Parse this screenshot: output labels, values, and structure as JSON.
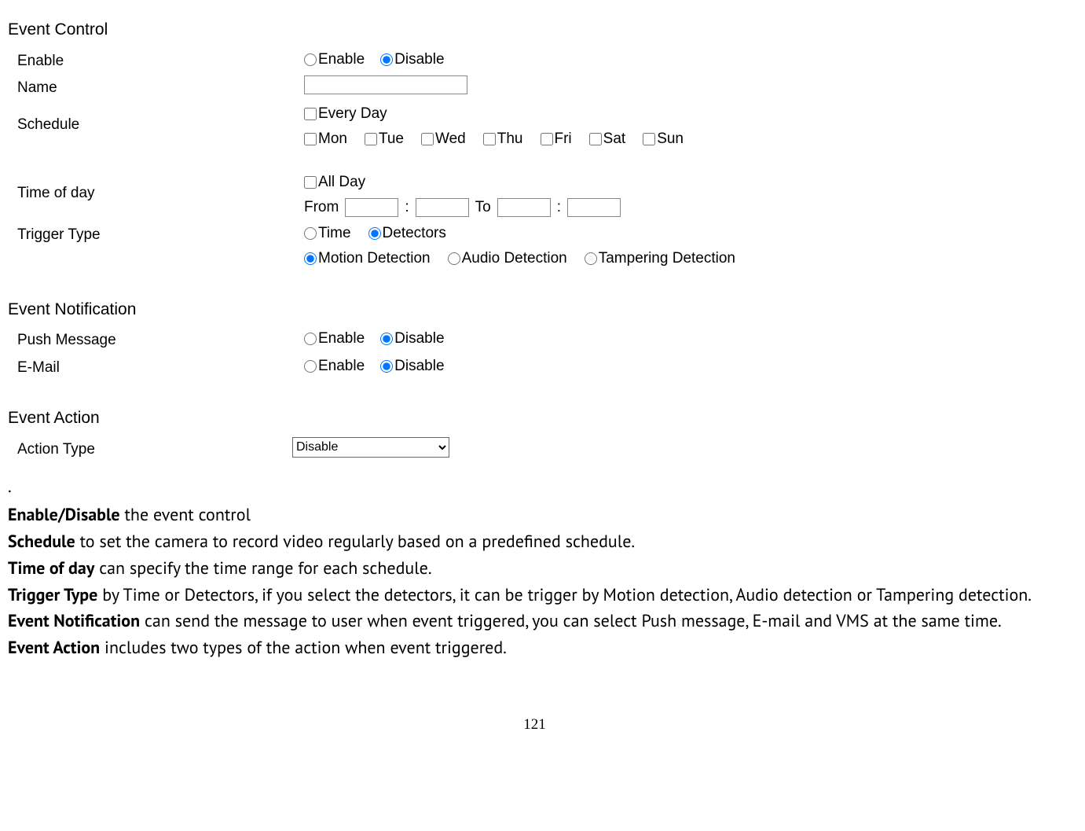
{
  "sections": {
    "event_control": "Event Control",
    "event_notification": "Event Notification",
    "event_action": "Event Action"
  },
  "labels": {
    "enable": "Enable",
    "name": "Name",
    "schedule": "Schedule",
    "time_of_day": "Time of day",
    "trigger_type": "Trigger Type",
    "push_message": "Push Message",
    "email": "E-Mail",
    "action_type": "Action Type"
  },
  "radios": {
    "enable": "Enable",
    "disable": "Disable",
    "time": "Time",
    "detectors": "Detectors",
    "motion": "Motion Detection",
    "audio": "Audio Detection",
    "tampering": "Tampering Detection"
  },
  "checks": {
    "every_day": "Every Day",
    "mon": "Mon",
    "tue": "Tue",
    "wed": "Wed",
    "thu": "Thu",
    "fri": "Fri",
    "sat": "Sat",
    "sun": "Sun",
    "all_day": "All Day"
  },
  "time": {
    "from": "From",
    "to": "To",
    "colon": ":"
  },
  "action_select": {
    "value": "Disable"
  },
  "desc": {
    "dot": ".",
    "l1b": "Enable/Disable",
    "l1": " the event control",
    "l2b": "Schedule",
    "l2": " to set the camera to record video regularly based on a predefined schedule.",
    "l3b": "Time of day",
    "l3": " can specify the time range for each schedule.",
    "l4b": "Trigger Type",
    "l4": " by Time or Detectors, if you select the detectors, it can be trigger by Motion detection, Audio detection or Tampering detection.",
    "l5b": "Event Notification",
    "l5": " can send the message to user when event triggered, you can select Push message, E-mail and VMS at the same time.",
    "l6b": "Event Action",
    "l6": " includes two types of the action when event triggered."
  },
  "page_number": "121"
}
